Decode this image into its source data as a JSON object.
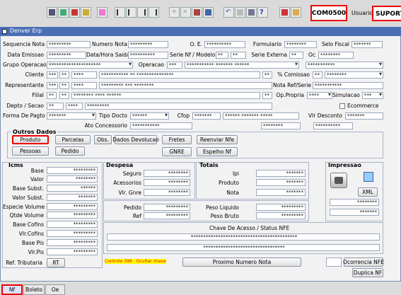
{
  "toolbar": {
    "module_code": "COM0500",
    "user_label": "Usuario",
    "user_value": "SUPORTE"
  },
  "window": {
    "title": "Denver Erp"
  },
  "header": {
    "sequencia_nota": {
      "label": "Sequencia Nota",
      "value": "*********"
    },
    "numero_nota": {
      "label": "Numero Nota",
      "value": "*********"
    },
    "oe": {
      "label": "O. E.",
      "value": "**********"
    },
    "formulario": {
      "label": "Formulario",
      "value": "********"
    },
    "selo_fiscal": {
      "label": "Selo Fiscal",
      "value": "*******"
    },
    "data_emissao": {
      "label": "Data Emissao",
      "value": "*********"
    },
    "data_hora_saida": {
      "label": "Data/Hora Saida",
      "value": "**********"
    },
    "serie_modelo": {
      "label": "Serie Nf / Modelo",
      "value1": "**",
      "value2": "**"
    },
    "serie_externa": {
      "label": "Serie Externa",
      "value": "**"
    },
    "oc": {
      "label": "Oc",
      "value": "********"
    },
    "grupo_operacao": {
      "label": "Grupo Operacao",
      "value": "*********************"
    },
    "operacao": {
      "label": "Operacao",
      "value1": "***",
      "value2": "*********** ******* ******"
    },
    "operacao_extra": "***********",
    "cliente": {
      "label": "Cliente",
      "v1": "***",
      "v2": "**",
      "v3": "****",
      "v4": "*********** ** ***************",
      "v5": "**"
    },
    "comissao": {
      "label": "% Comissao",
      "v1": "**",
      "v2": "********"
    },
    "representante": {
      "label": "Representante",
      "v1": "***",
      "v2": "**",
      "v3": "****",
      "v4": "********* *** ********"
    },
    "nota_ref": {
      "label": "Nota Ref/Serie",
      "value": "***********"
    },
    "filial": {
      "label": "Filial",
      "v1": "**",
      "v2": "**",
      "v3": "******** **** ******",
      "v4": "**"
    },
    "op_propria": {
      "label": "Op.Propria",
      "value": "****"
    },
    "simulacao": {
      "label": "Simulacao",
      "value": "***"
    },
    "depto": {
      "label": "Depto / Secao",
      "v1": "**",
      "v2": "****",
      "v3": "*********"
    },
    "ecommerce": {
      "label": "Ecommerce"
    },
    "forma_pagto": {
      "label": "Forma De Pagto",
      "value": "*******"
    },
    "tipo_docto": {
      "label": "Tipo Docto",
      "value": "******"
    },
    "cfop": {
      "label": "Cfop",
      "v1": "*******",
      "v2": "****** ******* *****"
    },
    "vlr_desconto": {
      "label": "Vlr Desconto",
      "value": "*******"
    },
    "ato_concessorio": {
      "label": "Ato Concessorio",
      "value": "***********"
    },
    "extra1": "********",
    "extra2": "**********"
  },
  "outros": {
    "title": "Outros Dados",
    "buttons": [
      "Produto",
      "Parcelas",
      "Obs.",
      "Dados Devolucao",
      "Fretes",
      "Reenviar Nfe",
      "Pessoas",
      "Pedido",
      "GNRE",
      "Espelho Nf"
    ]
  },
  "icms": {
    "title": "Icms",
    "fields": [
      {
        "label": "Base",
        "value": "*********"
      },
      {
        "label": "Valor",
        "value": "********"
      },
      {
        "label": "Base Subst.",
        "value": "******"
      },
      {
        "label": "Valor Subst.",
        "value": "*******"
      },
      {
        "label": "Especie Volume",
        "value": "*********"
      },
      {
        "label": "Qtde Volume",
        "value": "*********"
      },
      {
        "label": "Base Cofins",
        "value": "*********"
      },
      {
        "label": "Vlr.Cofins",
        "value": "*********"
      },
      {
        "label": "Base Pis",
        "value": "*********"
      },
      {
        "label": "Vlr.Pis",
        "value": "*********"
      }
    ],
    "ref_tributaria": "Ref. Tributaria",
    "rt_button": "RT"
  },
  "despesa": {
    "title": "Despesa",
    "fields": [
      {
        "label": "Seguro",
        "value": "********"
      },
      {
        "label": "Acessorios",
        "value": "********"
      },
      {
        "label": "Vlr. Gnre",
        "value": "********"
      },
      {
        "label": "Pedido",
        "value": "*********"
      },
      {
        "label": "Ref",
        "value": "*********"
      }
    ]
  },
  "totais": {
    "title": "Totais",
    "fields": [
      {
        "label": "Ipi",
        "value": "*******"
      },
      {
        "label": "Produto",
        "value": "*******"
      },
      {
        "label": "Nota",
        "value": "*******"
      },
      {
        "label": "Peso Liquido",
        "value": "*********"
      },
      {
        "label": "Peso Bruto",
        "value": "*********"
      }
    ]
  },
  "impressao": {
    "title": "Impressao",
    "xml_label": "XML",
    "v1": "********",
    "v2": "*******"
  },
  "chave": {
    "title": "Chave De Acesso / Status NFE",
    "line1": "*******************************************",
    "line2": "*********************************"
  },
  "controle": "Controle 399 -   Ocultar chave",
  "proximo": "Proximo Numero Nota",
  "ocorrencia": "Ocorrencia NFE",
  "duplica": "Duplica NF",
  "tabs": [
    "Nf",
    "Boleto",
    "Oe"
  ]
}
